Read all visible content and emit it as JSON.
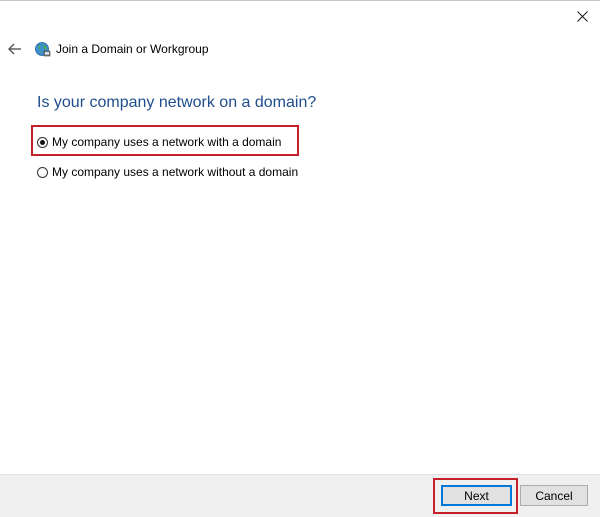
{
  "window": {
    "close_icon": "close-icon",
    "back_icon": "back-arrow-icon",
    "app_icon": "network-globe-icon",
    "title": "Join a Domain or Workgroup"
  },
  "main": {
    "heading": "Is your company network on a domain?",
    "options": [
      {
        "label": "My company uses a network with a domain",
        "selected": true
      },
      {
        "label": "My company uses a network without a domain",
        "selected": false
      }
    ]
  },
  "footer": {
    "next_label": "Next",
    "cancel_label": "Cancel"
  },
  "colors": {
    "heading": "#1f4e8c",
    "highlight": "#c4202b",
    "footer_bg": "#f0f0f0",
    "focus": "#0078d7"
  }
}
